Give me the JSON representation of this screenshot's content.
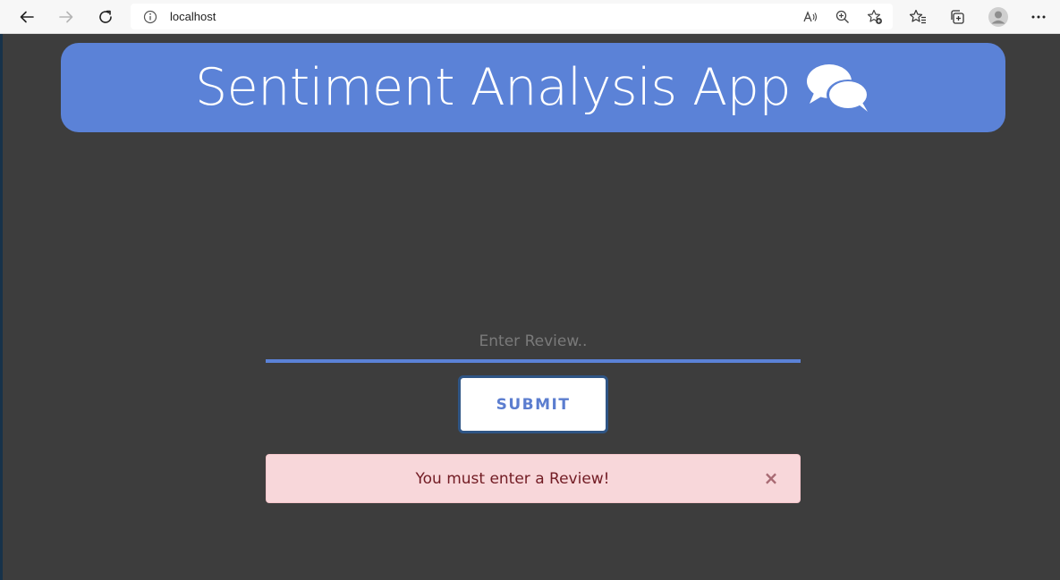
{
  "browser": {
    "url": "localhost",
    "icons": [
      "back-arrow-icon",
      "forward-arrow-icon",
      "refresh-icon",
      "info-icon",
      "read-aloud-icon",
      "zoom-icon",
      "add-favorite-icon",
      "favorites-icon",
      "collections-icon",
      "profile-icon",
      "more-icon"
    ]
  },
  "header": {
    "title": "Sentiment Analysis App",
    "icon": "comments-icon",
    "background_color": "#5b82d7"
  },
  "form": {
    "review_placeholder": "Enter Review..",
    "review_value": "",
    "submit_label": "SUBMIT"
  },
  "alert": {
    "message": "You must enter a Review!",
    "close_symbol": "×",
    "background_color": "#f8d7da",
    "text_color": "#721c24"
  },
  "colors": {
    "page_background": "#3d3d3d",
    "accent": "#5b82d7"
  }
}
